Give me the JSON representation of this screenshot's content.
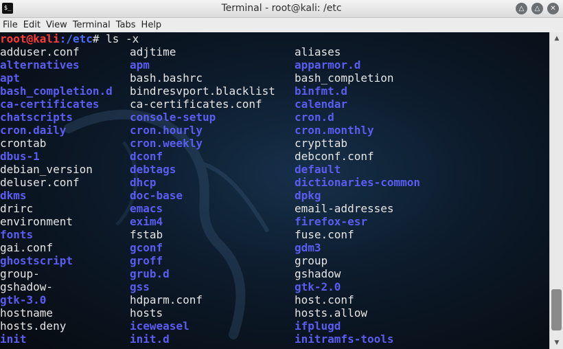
{
  "window": {
    "title": "Terminal - root@kali: /etc",
    "icon_text": "$_",
    "controls": [
      "minimize-icon",
      "maximize-icon",
      "close-icon"
    ]
  },
  "menu": [
    "File",
    "Edit",
    "View",
    "Terminal",
    "Tabs",
    "Help"
  ],
  "prompt": {
    "user_host": "root@kali",
    "path": ":/etc",
    "symbol": "#",
    "command": " ls -x"
  },
  "rows": [
    [
      {
        "t": "adduser.conf",
        "k": "file"
      },
      {
        "t": "adjtime",
        "k": "file"
      },
      {
        "t": "aliases",
        "k": "file"
      }
    ],
    [
      {
        "t": "alternatives",
        "k": "dir"
      },
      {
        "t": "apm",
        "k": "dir"
      },
      {
        "t": "apparmor.d",
        "k": "dir"
      }
    ],
    [
      {
        "t": "apt",
        "k": "dir"
      },
      {
        "t": "bash.bashrc",
        "k": "file"
      },
      {
        "t": "bash_completion",
        "k": "file"
      }
    ],
    [
      {
        "t": "bash_completion.d",
        "k": "dir"
      },
      {
        "t": "bindresvport.blacklist",
        "k": "file"
      },
      {
        "t": "binfmt.d",
        "k": "dir"
      }
    ],
    [
      {
        "t": "ca-certificates",
        "k": "dir"
      },
      {
        "t": "ca-certificates.conf",
        "k": "file"
      },
      {
        "t": "calendar",
        "k": "dir"
      }
    ],
    [
      {
        "t": "chatscripts",
        "k": "dir"
      },
      {
        "t": "console-setup",
        "k": "dir"
      },
      {
        "t": "cron.d",
        "k": "dir"
      }
    ],
    [
      {
        "t": "cron.daily",
        "k": "dir"
      },
      {
        "t": "cron.hourly",
        "k": "dir"
      },
      {
        "t": "cron.monthly",
        "k": "dir"
      }
    ],
    [
      {
        "t": "crontab",
        "k": "file"
      },
      {
        "t": "cron.weekly",
        "k": "dir"
      },
      {
        "t": "crypttab",
        "k": "file"
      }
    ],
    [
      {
        "t": "dbus-1",
        "k": "dir"
      },
      {
        "t": "dconf",
        "k": "dir"
      },
      {
        "t": "debconf.conf",
        "k": "file"
      }
    ],
    [
      {
        "t": "debian_version",
        "k": "file"
      },
      {
        "t": "debtags",
        "k": "dir"
      },
      {
        "t": "default",
        "k": "dir"
      }
    ],
    [
      {
        "t": "deluser.conf",
        "k": "file"
      },
      {
        "t": "dhcp",
        "k": "dir"
      },
      {
        "t": "dictionaries-common",
        "k": "dir"
      }
    ],
    [
      {
        "t": "dkms",
        "k": "dir"
      },
      {
        "t": "doc-base",
        "k": "dir"
      },
      {
        "t": "dpkg",
        "k": "dir"
      }
    ],
    [
      {
        "t": "drirc",
        "k": "file"
      },
      {
        "t": "emacs",
        "k": "dir"
      },
      {
        "t": "email-addresses",
        "k": "file"
      }
    ],
    [
      {
        "t": "environment",
        "k": "file"
      },
      {
        "t": "exim4",
        "k": "dir"
      },
      {
        "t": "firefox-esr",
        "k": "dir"
      }
    ],
    [
      {
        "t": "fonts",
        "k": "dir"
      },
      {
        "t": "fstab",
        "k": "file"
      },
      {
        "t": "fuse.conf",
        "k": "file"
      }
    ],
    [
      {
        "t": "gai.conf",
        "k": "file"
      },
      {
        "t": "gconf",
        "k": "dir"
      },
      {
        "t": "gdm3",
        "k": "dir"
      }
    ],
    [
      {
        "t": "ghostscript",
        "k": "dir"
      },
      {
        "t": "groff",
        "k": "dir"
      },
      {
        "t": "group",
        "k": "file"
      }
    ],
    [
      {
        "t": "group-",
        "k": "file"
      },
      {
        "t": "grub.d",
        "k": "dir"
      },
      {
        "t": "gshadow",
        "k": "file"
      }
    ],
    [
      {
        "t": "gshadow-",
        "k": "file"
      },
      {
        "t": "gss",
        "k": "dir"
      },
      {
        "t": "gtk-2.0",
        "k": "dir"
      }
    ],
    [
      {
        "t": "gtk-3.0",
        "k": "dir"
      },
      {
        "t": "hdparm.conf",
        "k": "file"
      },
      {
        "t": "host.conf",
        "k": "file"
      }
    ],
    [
      {
        "t": "hostname",
        "k": "file"
      },
      {
        "t": "hosts",
        "k": "file"
      },
      {
        "t": "hosts.allow",
        "k": "file"
      }
    ],
    [
      {
        "t": "hosts.deny",
        "k": "file"
      },
      {
        "t": "iceweasel",
        "k": "dir"
      },
      {
        "t": "ifplugd",
        "k": "dir"
      }
    ],
    [
      {
        "t": "init",
        "k": "dir"
      },
      {
        "t": "init.d",
        "k": "dir"
      },
      {
        "t": "initramfs-tools",
        "k": "dir"
      }
    ]
  ],
  "colors": {
    "file": "#e6e6e6",
    "dir": "#5a5df0",
    "prompt_user": "#ff3a3a",
    "prompt_path": "#4a6cff"
  }
}
